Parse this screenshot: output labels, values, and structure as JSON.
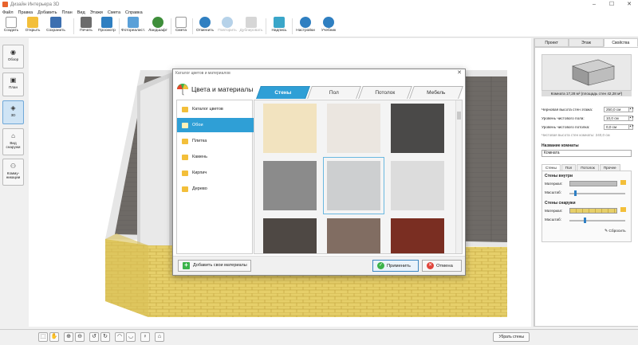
{
  "window": {
    "title": "Дизайн Интерьера 3D",
    "controls": [
      "–",
      "☐",
      "✕"
    ]
  },
  "menu": [
    "Файл",
    "Правка",
    "Добавить",
    "План",
    "Вид",
    "Этажи",
    "Смета",
    "Справка"
  ],
  "toolbar": {
    "create": "Создать",
    "open": "Открыть",
    "save": "Сохранить",
    "print": "Печать",
    "preview": "Просмотр",
    "photo": "Фотореалист.",
    "landscape": "Ландшафт",
    "estimate": "Смета",
    "undo": "Отменить",
    "redo": "Повторить",
    "duplicate": "Дублировать",
    "labels": "Надпись",
    "settings": "Настройки",
    "tutorial": "Учебник"
  },
  "leftnav": {
    "overview": "Обзор",
    "plan": "План",
    "view3d": "3D",
    "outside": "Вид снаружи",
    "walkthrough": "Комму- никации"
  },
  "bottom": {
    "remove_walls": "Убрать стены"
  },
  "right": {
    "tabs": [
      "Проект",
      "Этаж",
      "Свойства"
    ],
    "room_caption": "Комната 17,28 м²  (площадь стен 42,28 м²)",
    "rows": [
      {
        "label": "Черновая высота стен этажа:",
        "value": "250,0 см"
      },
      {
        "label": "Уровень чистового пола:",
        "value": "10,0 см"
      },
      {
        "label": "Уровень чистового потолка:",
        "value": "0,0 см"
      }
    ],
    "hint": "Чистовая высота стен комнаты: 240,0 см",
    "name_label": "Название комнаты",
    "name_value": "Комната",
    "inner_tabs": [
      "Стены",
      "Пол",
      "Потолок",
      "Прочее"
    ],
    "walls_in": "Стены внутри",
    "walls_out": "Стены снаружи",
    "material": "Материал:",
    "scale": "Масштаб:",
    "reset": "Сбросить"
  },
  "dialog": {
    "title": "Каталог цветов и материалов",
    "heading": "Цвета и материалы",
    "tabs": [
      "Стены",
      "Пол",
      "Потолок",
      "Мебель"
    ],
    "categories": [
      "Каталог цветов",
      "Обои",
      "Плитка",
      "Камень",
      "Кирпич",
      "Дерево"
    ],
    "swatches": [
      "#f2e3bf",
      "#ebe6e0",
      "#4a4948",
      "#8b8b8b",
      "#cdcfd0",
      "#dcdcdc",
      "#4e4844",
      "#816d62",
      "#7a2e22"
    ],
    "add_button": "Добавить свои материалы",
    "apply": "Применить",
    "cancel": "Отмена"
  },
  "colors": {
    "accent": "#2f9fd6",
    "brick": "#e6cf6a",
    "floor": "#6e6a66"
  }
}
